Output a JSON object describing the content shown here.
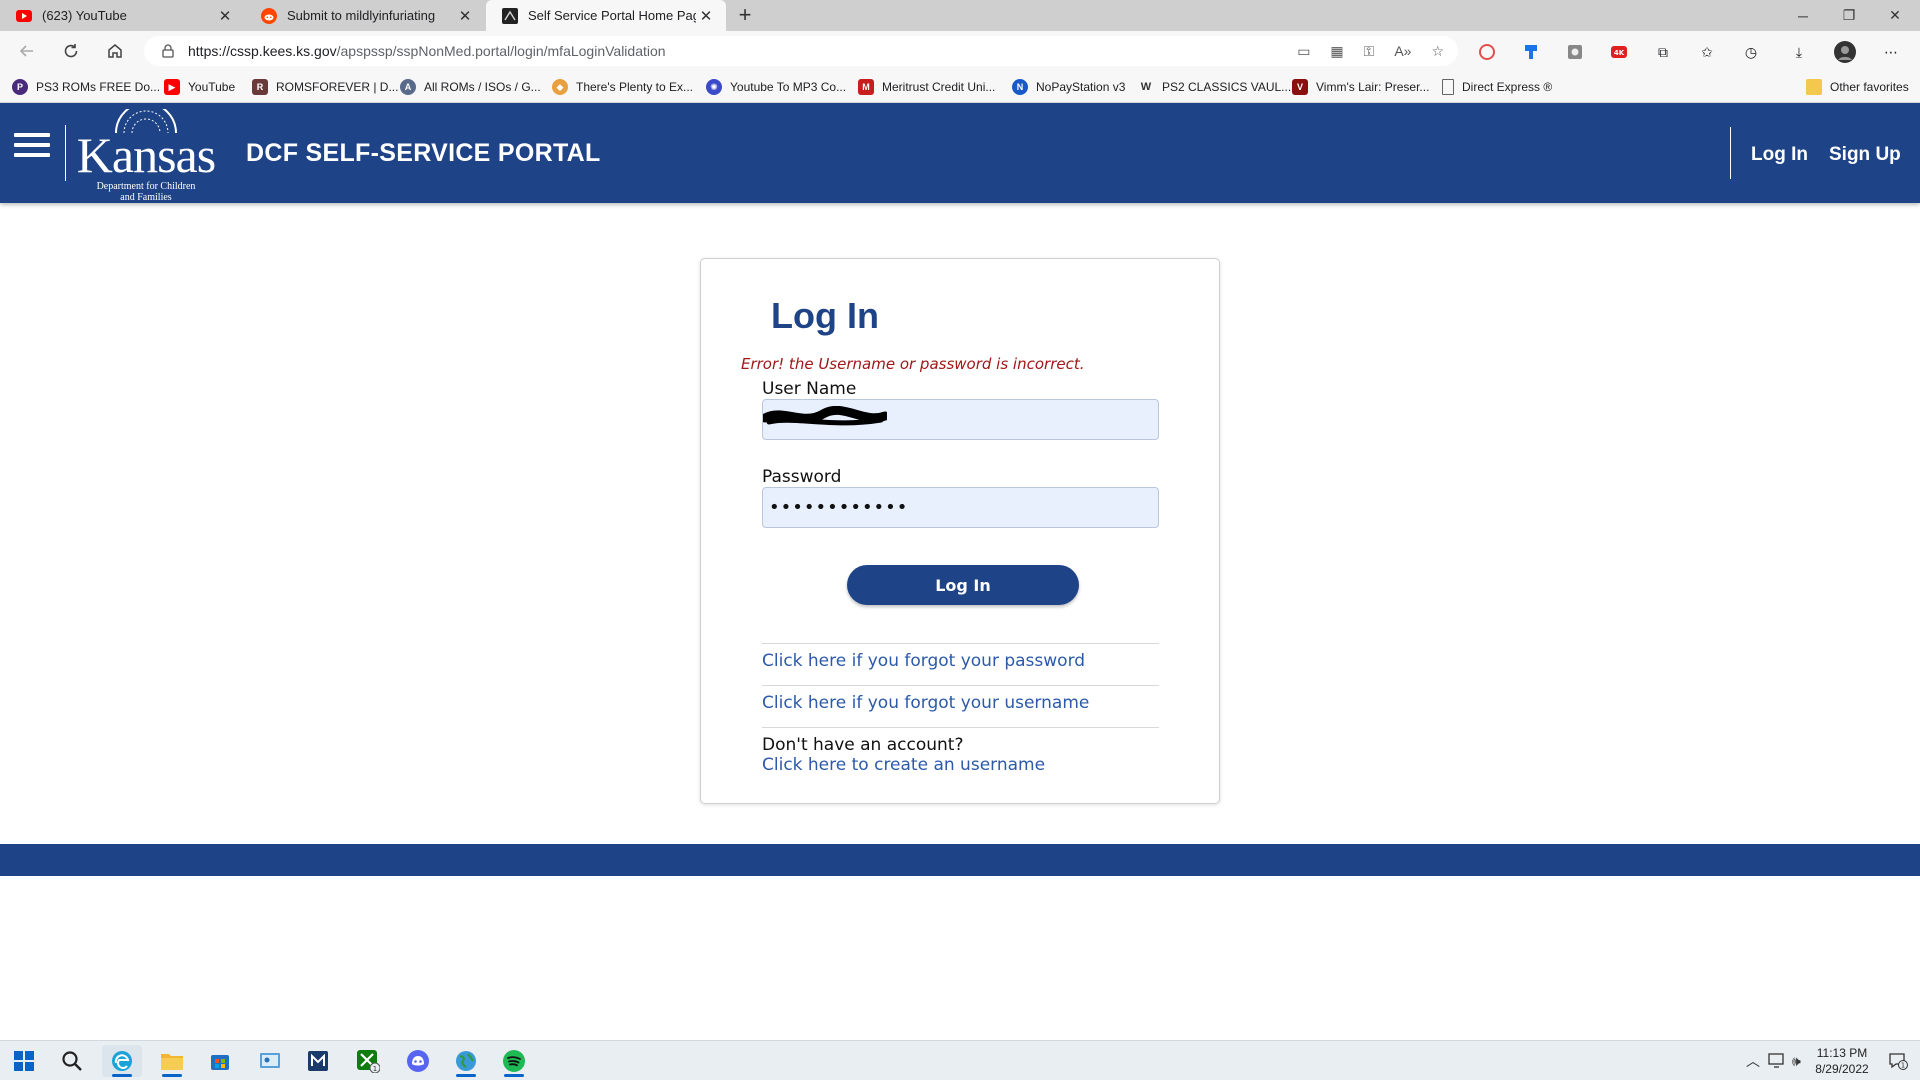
{
  "browser": {
    "tabs": [
      {
        "title": "(623) YouTube",
        "icon": "youtube-icon",
        "active": false
      },
      {
        "title": "Submit to mildlyinfuriating",
        "icon": "reddit-icon",
        "active": false
      },
      {
        "title": "Self Service Portal Home Page",
        "icon": "portal-favicon-icon",
        "active": true
      }
    ],
    "url_host": "https://cssp.kees.ks.gov",
    "url_path": "/apspssp/sspNonMed.portal/login/mfaLoginValidation",
    "bookmarks": [
      "PS3 ROMs FREE Do...",
      "YouTube",
      "ROMSFOREVER | D...",
      "All ROMs / ISOs / G...",
      "There's Plenty to Ex...",
      "Youtube To MP3 Co...",
      "Meritrust Credit Uni...",
      "NoPayStation v3",
      "PS2 CLASSICS VAUL...",
      "Vimm's Lair: Preser...",
      "Direct Express ®"
    ],
    "other_favorites": "Other favorites"
  },
  "header": {
    "logo_word": "Kansas",
    "logo_sub_line1": "Department for Children",
    "logo_sub_line2": "and Families",
    "title": "DCF SELF-SERVICE PORTAL",
    "login_link": "Log In",
    "signup_link": "Sign Up",
    "brand_color": "#1f4387"
  },
  "login": {
    "heading": "Log In",
    "error": "Error! the Username or password is incorrect.",
    "username_label": "User Name",
    "password_label": "Password",
    "password_value": "••••••••••••",
    "button": "Log In",
    "forgot_password": "Click here if you forgot your password",
    "forgot_username": "Click here if you forgot your username",
    "no_account": "Don't have an account?",
    "create_username": "Click here to create an username"
  },
  "taskbar": {
    "time": "11:13 PM",
    "date": "8/29/2022",
    "notification_count": "1"
  }
}
